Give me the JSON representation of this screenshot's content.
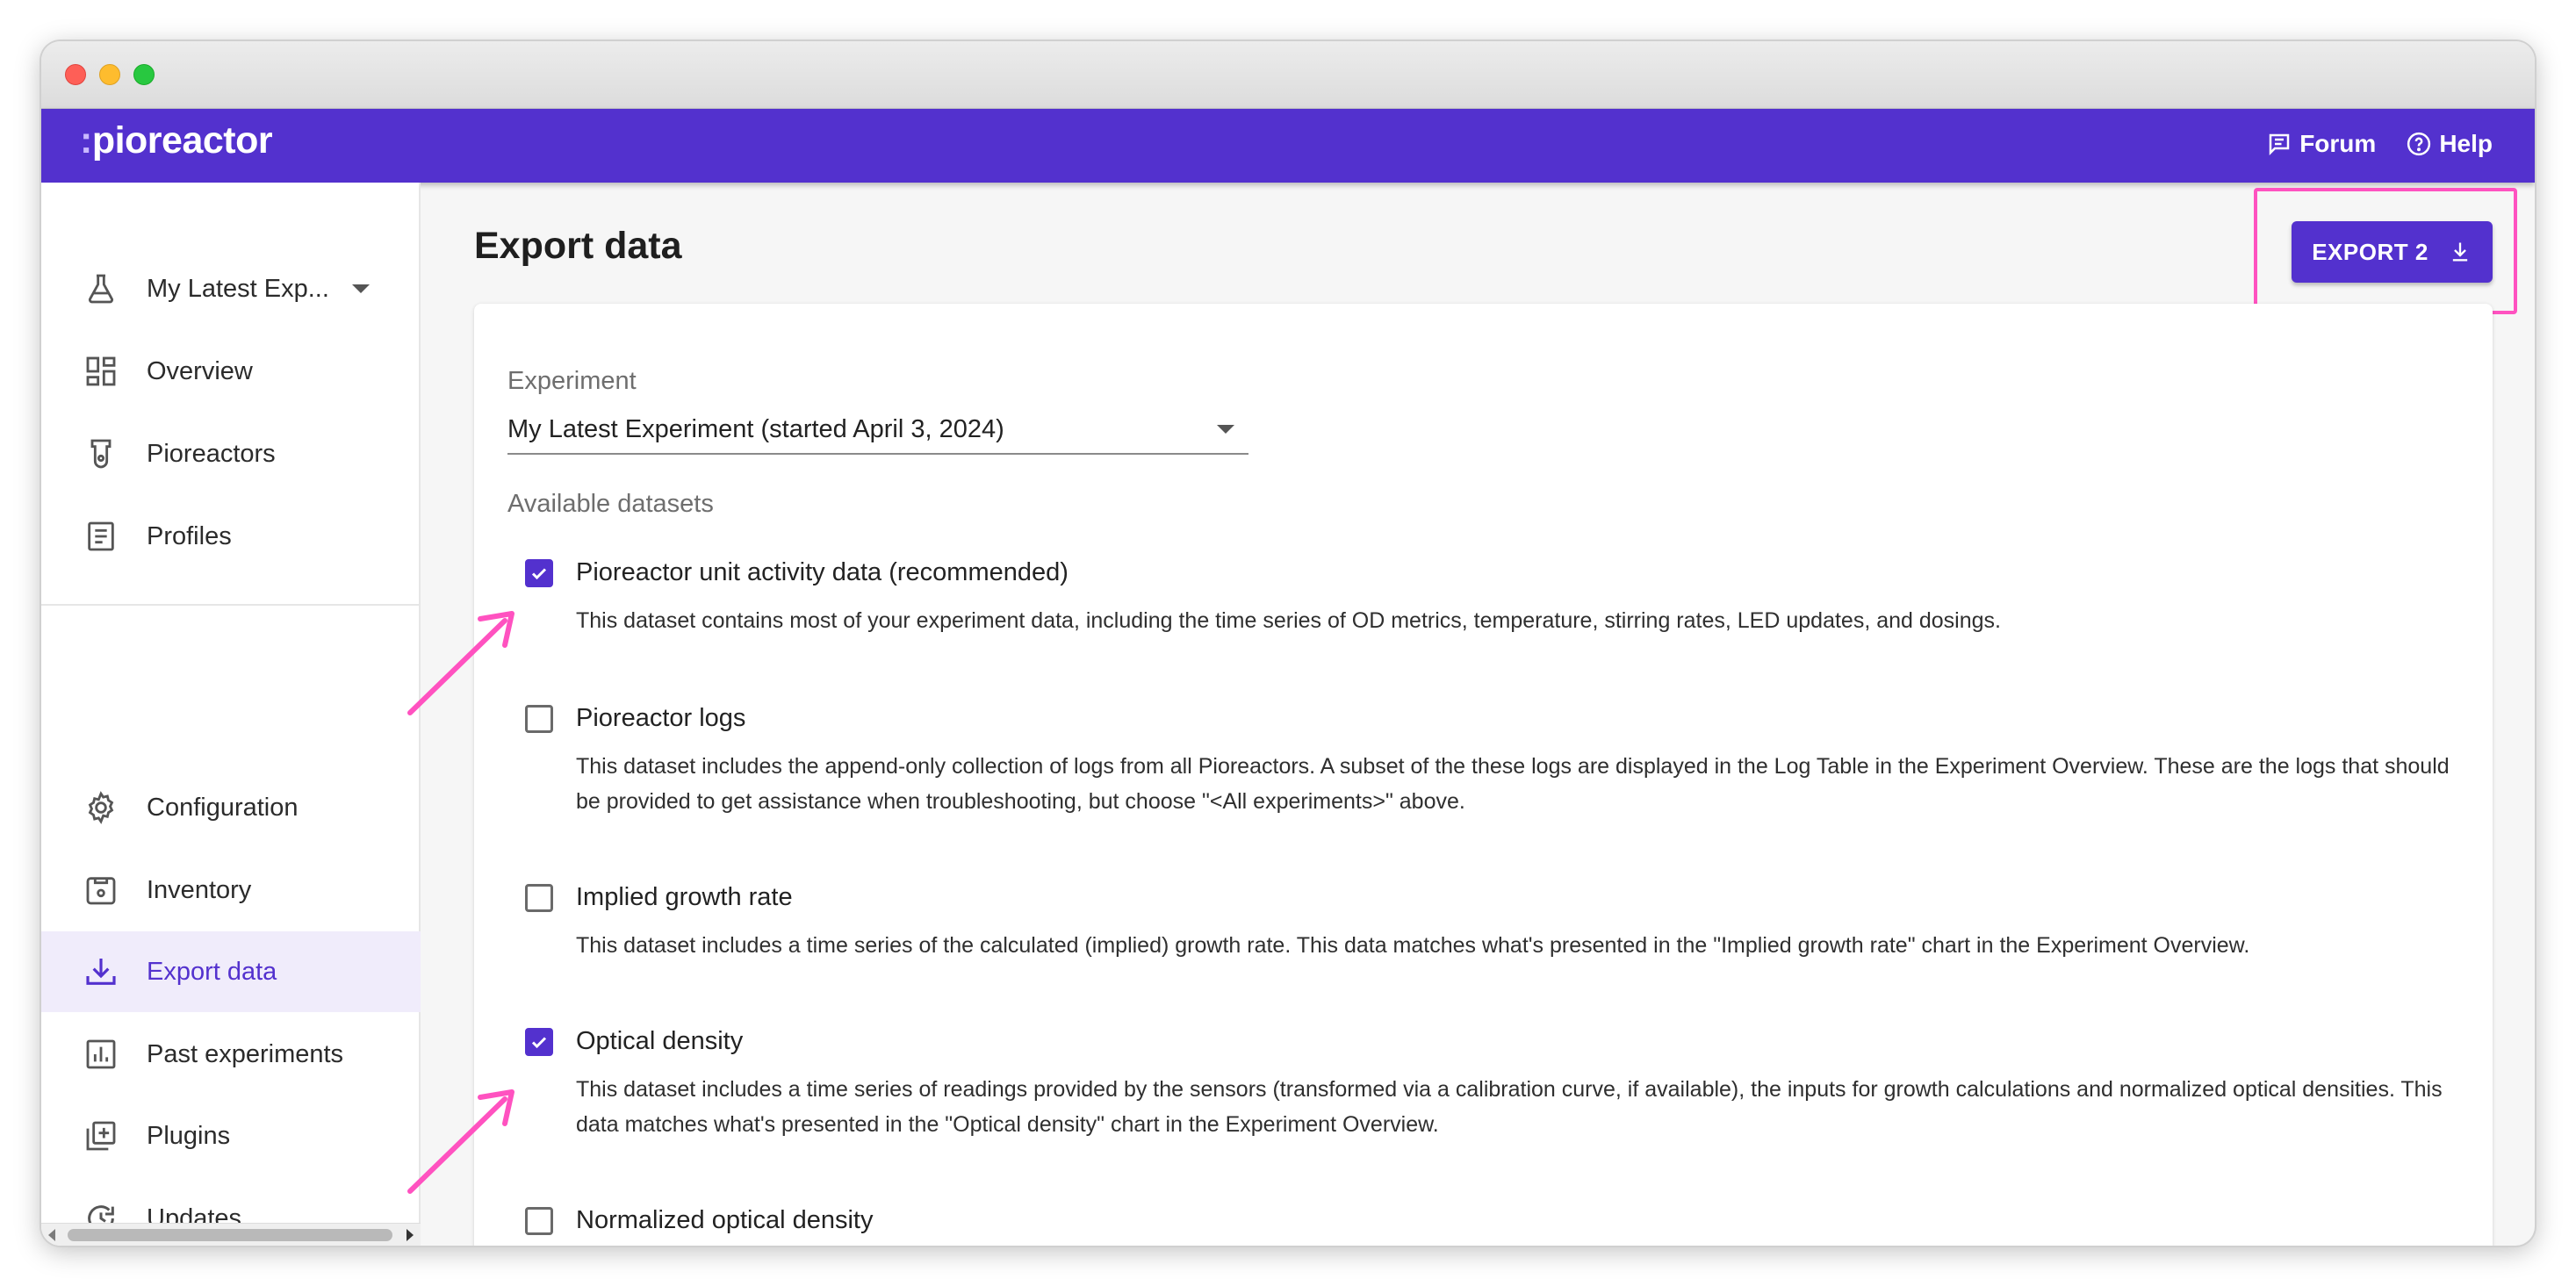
{
  "window": {
    "controls": [
      "close",
      "minimize",
      "zoom"
    ]
  },
  "appbar": {
    "logo": "pioreactor",
    "logo_prefix": ":",
    "links": [
      {
        "label": "Forum",
        "icon": "forum-icon"
      },
      {
        "label": "Help",
        "icon": "help-icon"
      }
    ]
  },
  "sidebar": {
    "experiment_select": "My Latest Exp...",
    "items_top": [
      {
        "label": "Overview",
        "icon": "dashboard-icon"
      },
      {
        "label": "Pioreactors",
        "icon": "pioreactor-icon"
      },
      {
        "label": "Profiles",
        "icon": "profiles-icon"
      }
    ],
    "items_bottom": [
      {
        "label": "Configuration",
        "icon": "gear-icon"
      },
      {
        "label": "Inventory",
        "icon": "inventory-icon"
      },
      {
        "label": "Export data",
        "icon": "download-icon",
        "active": true
      },
      {
        "label": "Past experiments",
        "icon": "chart-icon"
      },
      {
        "label": "Plugins",
        "icon": "plugin-icon"
      },
      {
        "label": "Updates",
        "icon": "update-icon"
      }
    ]
  },
  "main": {
    "title": "Export data",
    "export_button": "EXPORT 2",
    "experiment_label": "Experiment",
    "experiment_value": "My Latest Experiment (started April 3, 2024)",
    "datasets_label": "Available datasets",
    "datasets": [
      {
        "name": "Pioreactor unit activity data (recommended)",
        "checked": true,
        "description": "This dataset contains most of your experiment data, including the time series of OD metrics, temperature, stirring rates, LED updates, and dosings."
      },
      {
        "name": "Pioreactor logs",
        "checked": false,
        "description": "This dataset includes the append-only collection of logs from all Pioreactors. A subset of the these logs are displayed in the Log Table in the Experiment Overview. These are the logs that should be provided to get assistance when troubleshooting, but choose \"<All experiments>\" above."
      },
      {
        "name": "Implied growth rate",
        "checked": false,
        "description": "This dataset includes a time series of the calculated (implied) growth rate. This data matches what's presented in the \"Implied growth rate\" chart in the Experiment Overview."
      },
      {
        "name": "Optical density",
        "checked": true,
        "description": "This dataset includes a time series of readings provided by the sensors (transformed via a calibration curve, if available), the inputs for growth calculations and normalized optical densities. This data matches what's presented in the \"Optical density\" chart in the Experiment Overview."
      },
      {
        "name": "Normalized optical density",
        "checked": false,
        "description": ""
      }
    ]
  },
  "colors": {
    "brand": "#5331ce",
    "annotation": "#ff52c0"
  }
}
